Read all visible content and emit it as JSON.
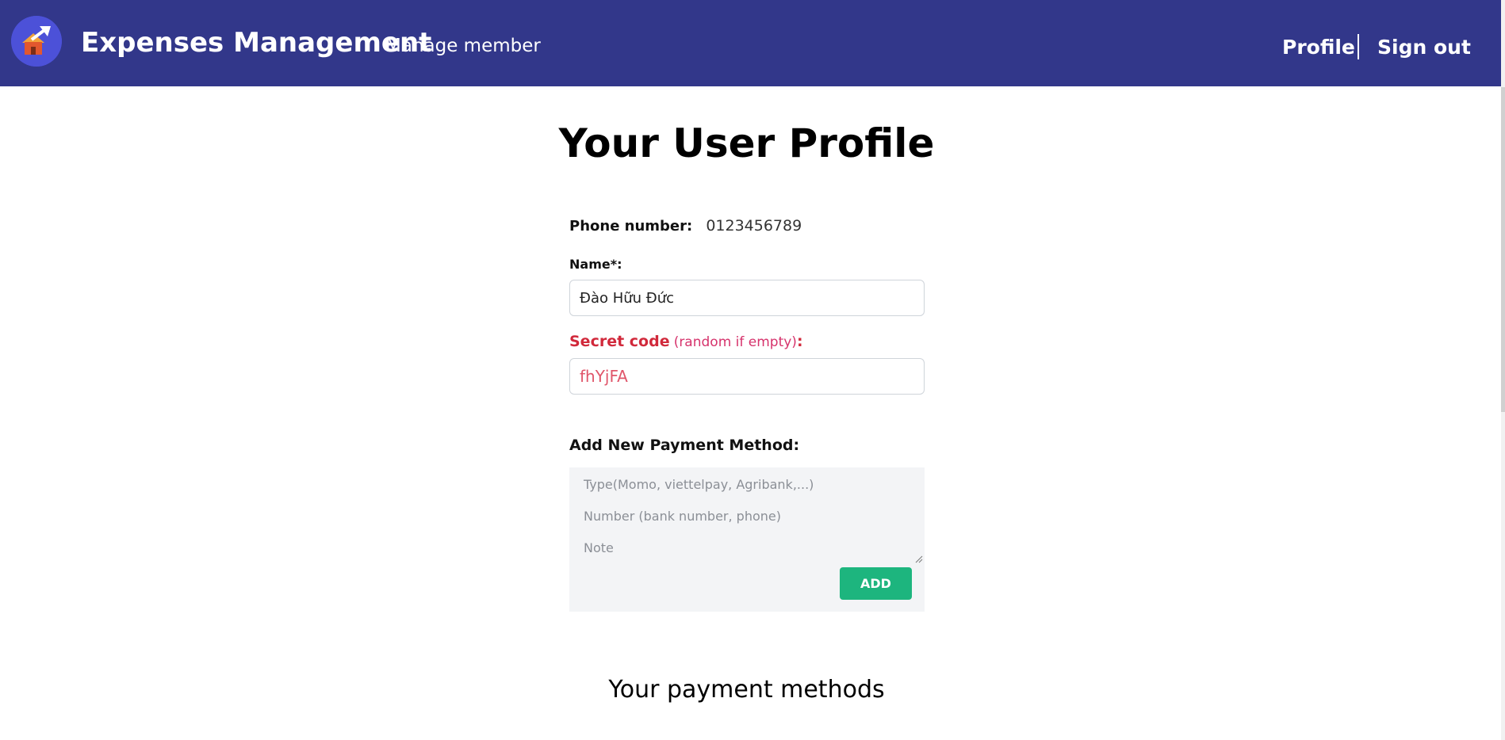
{
  "navbar": {
    "brand": "Expenses Management",
    "manage_member": "Manage member",
    "profile": "Profile",
    "sign_out": "Sign out",
    "logo_icon": "house-with-arrow-logo",
    "bg_color": "#32378a"
  },
  "page": {
    "title": "Your User Profile"
  },
  "profile": {
    "phone_label": "Phone number:",
    "phone_value": "0123456789",
    "name_label": "Name*:",
    "name_value": "Đào Hữu Đức",
    "secret_label": "Secret code",
    "secret_hint": "(random if empty)",
    "secret_colon": ":",
    "secret_value": "fhYjFA"
  },
  "payment_form": {
    "heading": "Add New Payment Method:",
    "type_placeholder": "Type(Momo, viettelpay, Agribank,...)",
    "number_placeholder": "Number (bank number, phone)",
    "note_placeholder": "Note",
    "add_label": "ADD",
    "add_color": "#1db57e"
  },
  "payment_methods": {
    "title": "Your payment methods"
  }
}
